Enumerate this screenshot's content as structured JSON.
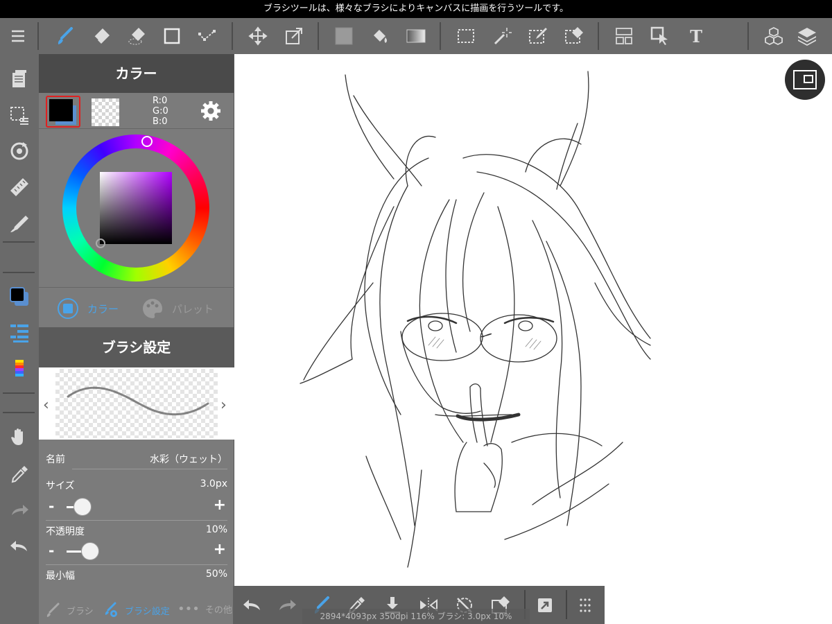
{
  "status_bar": {
    "message": "ブラシツールは、様々なブラシによりキャンバスに描画を行うツールです。"
  },
  "toolbar": {
    "icons": [
      "menu-icon",
      "brush-icon",
      "eraser-icon",
      "blur-eraser-icon",
      "shape-icon",
      "line-icon",
      "move-icon",
      "transform-icon",
      "fill-color-icon",
      "bucket-icon",
      "gradient-icon",
      "select-icon",
      "magic-wand-icon",
      "select-pen-icon",
      "select-eraser-icon",
      "frame-icon",
      "object-select-icon",
      "text-icon",
      "3d-object-icon",
      "layers-icon"
    ]
  },
  "color_panel": {
    "title": "カラー",
    "rgb": {
      "r": "R:0",
      "g": "G:0",
      "b": "B:0"
    },
    "foreground": "#000000",
    "background": "#5a8fd0",
    "tabs": {
      "color": "カラー",
      "palette": "パレット"
    }
  },
  "brush_panel": {
    "title": "ブラシ設定",
    "name_label": "名前",
    "name_value": "水彩（ウェット）",
    "size_label": "サイズ",
    "size_value": "3.0px",
    "size_fraction": 0.05,
    "opacity_label": "不透明度",
    "opacity_value": "10%",
    "opacity_fraction": 0.1,
    "minwidth_label": "最小幅",
    "minwidth_value": "50%",
    "minus": "-",
    "plus": "+",
    "tabs": {
      "brush": "ブラシ",
      "settings": "ブラシ設定",
      "other": "その他"
    }
  },
  "bottom_bar": {
    "info": "2894*4093px 350dpi 116% ブラシ: 3.0px 10%"
  },
  "colors": {
    "accent": "#4aa3e8",
    "panel": "#7b7b7b",
    "toolbar": "#6a6a6a"
  }
}
